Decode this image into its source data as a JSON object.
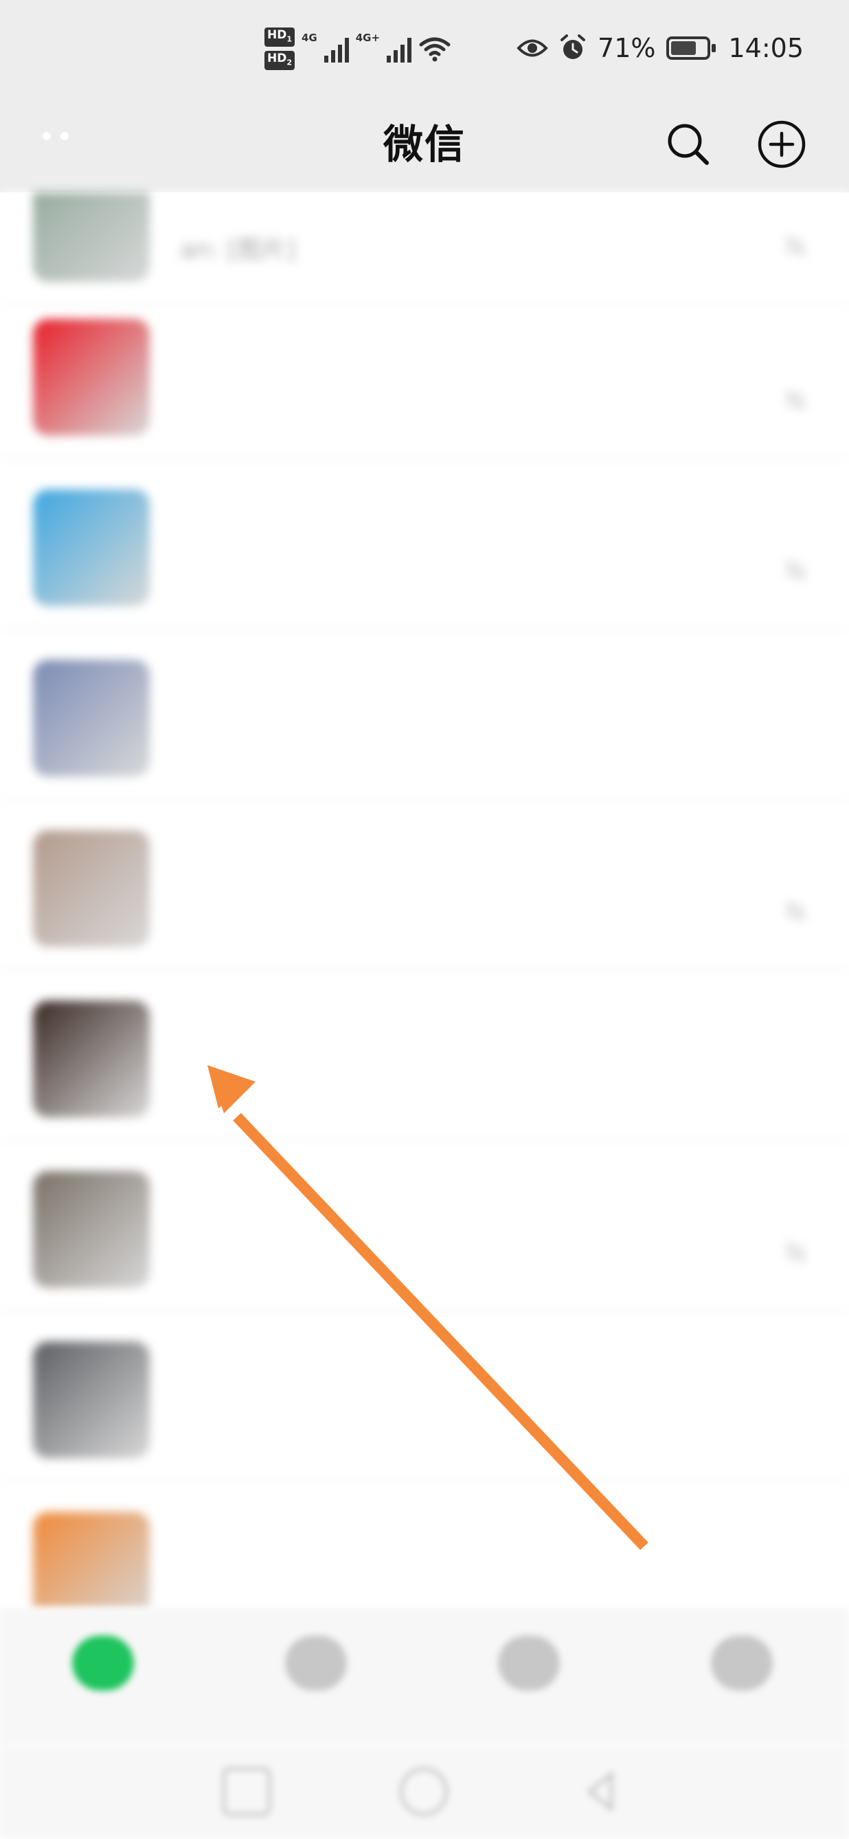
{
  "status_bar": {
    "hd1": "HD",
    "hd1_sub": "1",
    "hd2": "HD",
    "hd2_sub": "2",
    "net1": "4G",
    "net2": "4G+",
    "battery_percent": "71%",
    "battery_level": 0.71,
    "time": "14:05",
    "icons": [
      "signal-icon",
      "wifi-icon",
      "eye-icon",
      "alarm-icon",
      "battery-icon"
    ]
  },
  "header": {
    "title": "微信",
    "icons": [
      "more-dots-icon",
      "search-icon",
      "add-circle-icon"
    ]
  },
  "chats": [
    {
      "name": "",
      "preview": "an: [图片]",
      "time": "",
      "muted": true,
      "avatar_color": "#8fa79a",
      "name_style": "normal"
    },
    {
      "name": "",
      "preview": "",
      "time": "",
      "muted": true,
      "avatar_color": "#e8202a",
      "name_style": "blue"
    },
    {
      "name": "",
      "preview": "",
      "time": "",
      "muted": true,
      "avatar_color": "#3ea7e0",
      "name_style": "blue"
    },
    {
      "name": "",
      "preview": "",
      "time": "",
      "muted": false,
      "avatar_color": "#7b8bb5",
      "name_style": "normal"
    },
    {
      "name": "",
      "preview": "",
      "time": "",
      "muted": true,
      "avatar_color": "#b39a8c",
      "name_style": "normal"
    },
    {
      "name": "",
      "preview": "",
      "time": "",
      "muted": false,
      "avatar_color": "#3b2a25",
      "name_style": "normal"
    },
    {
      "name": "",
      "preview": "",
      "time": "",
      "muted": true,
      "avatar_color": "#7a7168",
      "name_style": "normal"
    },
    {
      "name": "",
      "preview": "",
      "time": "",
      "muted": false,
      "avatar_color": "#5d5f63",
      "name_style": "normal"
    },
    {
      "name": "",
      "preview": "",
      "time": "",
      "muted": false,
      "avatar_color": "#f08a3a",
      "name_style": "normal"
    }
  ],
  "tabs": [
    {
      "label": "",
      "active": true
    },
    {
      "label": "",
      "active": false
    },
    {
      "label": "",
      "active": false
    },
    {
      "label": "",
      "active": false
    }
  ],
  "colors": {
    "header_bg": "#ededed",
    "accent_green": "#07c160",
    "arrow": "#f5893a"
  }
}
